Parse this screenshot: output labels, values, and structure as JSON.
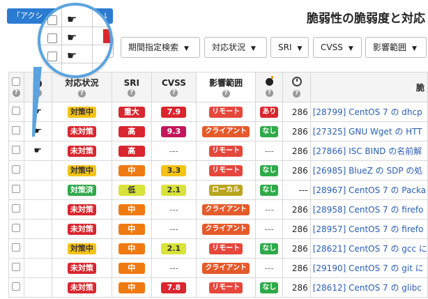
{
  "header": {
    "action_button": "「アクシ",
    "title": "脆弱性の脆弱度と対応"
  },
  "filters": [
    {
      "label": "期間指定検索"
    },
    {
      "label": "対応状況"
    },
    {
      "label": "SRI"
    },
    {
      "label": "CVSS"
    },
    {
      "label": "影響範囲"
    }
  ],
  "table": {
    "columns": [
      "",
      "!",
      "対応状況",
      "SRI",
      "CVSS",
      "影響範囲",
      "bomb",
      "clock",
      "脆"
    ],
    "rows": [
      {
        "hand": true,
        "status": "対策中",
        "status_color": "yellow",
        "sri": "重大",
        "sri_color": "#d9262f",
        "cvss": "7.9",
        "cvss_color": "#d9262f",
        "impact": "リモート",
        "impact_type": "remote",
        "bomb": "あり",
        "bomb_color": "#d9262f",
        "days": "286",
        "title": "[28799] CentOS 7 の dhcp"
      },
      {
        "hand": true,
        "status": "未対策",
        "status_color": "red",
        "sri": "高",
        "sri_color": "#d9262f",
        "cvss": "9.3",
        "cvss_color": "#c2185b",
        "impact": "クライアント",
        "impact_type": "client",
        "bomb": "なし",
        "bomb_color": "#2eaa4a",
        "days": "286",
        "title": "[27325] GNU Wget の HTT"
      },
      {
        "hand": true,
        "status": "未対策",
        "status_color": "red",
        "sri": "高",
        "sri_color": "#d9262f",
        "cvss": "---",
        "cvss_color": "",
        "impact": "リモート",
        "impact_type": "remote",
        "bomb": "---",
        "bomb_color": "",
        "days": "286",
        "title": "[27866] ISC BIND の名前解"
      },
      {
        "hand": false,
        "status": "対策中",
        "status_color": "yellow",
        "sri": "中",
        "sri_color": "#f07a12",
        "cvss": "3.3",
        "cvss_color": "#f5c316",
        "impact": "リモート",
        "impact_type": "remote",
        "bomb": "なし",
        "bomb_color": "#2eaa4a",
        "days": "286",
        "title": "[26985] BlueZ の SDP の処"
      },
      {
        "hand": false,
        "status": "対策済",
        "status_color": "green",
        "sri": "低",
        "sri_color": "#d8e23a",
        "cvss": "2.1",
        "cvss_color": "#d8e23a",
        "impact": "ローカル",
        "impact_type": "local",
        "bomb": "なし",
        "bomb_color": "#2eaa4a",
        "days": "---",
        "title": "[28967] CentOS 7 の Packa"
      },
      {
        "hand": false,
        "status": "未対策",
        "status_color": "red",
        "sri": "中",
        "sri_color": "#f07a12",
        "cvss": "---",
        "cvss_color": "",
        "impact": "クライアント",
        "impact_type": "client",
        "bomb": "---",
        "bomb_color": "",
        "days": "286",
        "title": "[28958] CentOS 7 の firefo"
      },
      {
        "hand": false,
        "status": "未対策",
        "status_color": "red",
        "sri": "中",
        "sri_color": "#f07a12",
        "cvss": "---",
        "cvss_color": "",
        "impact": "クライアント",
        "impact_type": "client",
        "bomb": "---",
        "bomb_color": "",
        "days": "286",
        "title": "[28957] CentOS 7 の firefo"
      },
      {
        "hand": false,
        "status": "対策中",
        "status_color": "yellow",
        "sri": "中",
        "sri_color": "#f07a12",
        "cvss": "2.1",
        "cvss_color": "#d8e23a",
        "impact": "リモート",
        "impact_type": "remote",
        "bomb": "なし",
        "bomb_color": "#2eaa4a",
        "days": "286",
        "title": "[28621] CentOS 7 の gcc に"
      },
      {
        "hand": false,
        "status": "未対策",
        "status_color": "red",
        "sri": "中",
        "sri_color": "#f07a12",
        "cvss": "---",
        "cvss_color": "",
        "impact": "クライアント",
        "impact_type": "client",
        "bomb": "---",
        "bomb_color": "",
        "days": "286",
        "title": "[29190] CentOS 7 の git に"
      },
      {
        "hand": false,
        "status": "未対策",
        "status_color": "red",
        "sri": "中",
        "sri_color": "#f07a12",
        "cvss": "7.8",
        "cvss_color": "#d9262f",
        "impact": "リモート",
        "impact_type": "remote",
        "bomb": "なし",
        "bomb_color": "#2eaa4a",
        "days": "286",
        "title": "[28612] CentOS 7 の glibc"
      }
    ]
  }
}
